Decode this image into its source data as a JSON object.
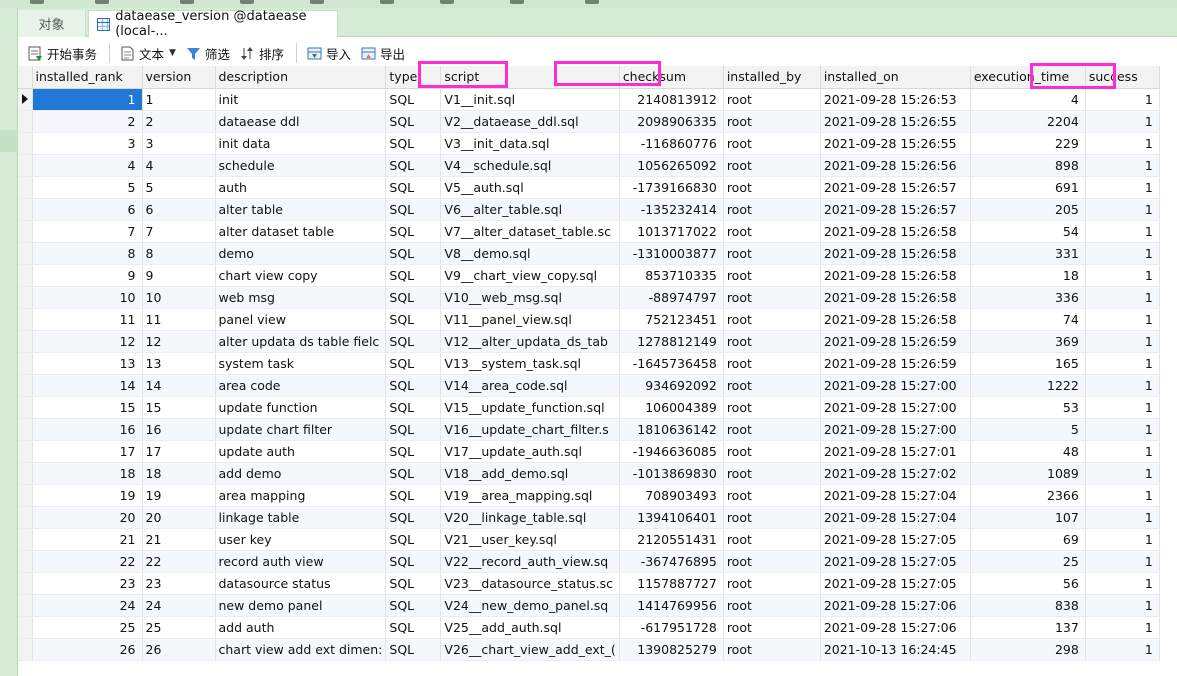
{
  "tabs": {
    "objects_label": "对象",
    "active_label": "dataease_version @dataease (local-..."
  },
  "toolbar": {
    "begin_tx": "开始事务",
    "text": "文本",
    "filter": "筛选",
    "sort": "排序",
    "import": "导入",
    "export": "导出"
  },
  "colors": {
    "accent": "#1f77d6",
    "highlight": "#ff2bd6",
    "panel": "#d6ecd6"
  },
  "table": {
    "columns": [
      "installed_rank",
      "version",
      "description",
      "type",
      "script",
      "checksum",
      "installed_by",
      "installed_on",
      "execution_time",
      "success"
    ],
    "highlighted_columns": [
      "script",
      "checksum",
      "success"
    ],
    "rows": [
      [
        "1",
        "1",
        "init",
        "SQL",
        "V1__init.sql",
        "2140813912",
        "root",
        "2021-09-28 15:26:53",
        "4",
        "1"
      ],
      [
        "2",
        "2",
        "dataease ddl",
        "SQL",
        "V2__dataease_ddl.sql",
        "2098906335",
        "root",
        "2021-09-28 15:26:55",
        "2204",
        "1"
      ],
      [
        "3",
        "3",
        "init data",
        "SQL",
        "V3__init_data.sql",
        "-116860776",
        "root",
        "2021-09-28 15:26:55",
        "229",
        "1"
      ],
      [
        "4",
        "4",
        "schedule",
        "SQL",
        "V4__schedule.sql",
        "1056265092",
        "root",
        "2021-09-28 15:26:56",
        "898",
        "1"
      ],
      [
        "5",
        "5",
        "auth",
        "SQL",
        "V5__auth.sql",
        "-1739166830",
        "root",
        "2021-09-28 15:26:57",
        "691",
        "1"
      ],
      [
        "6",
        "6",
        "alter table",
        "SQL",
        "V6__alter_table.sql",
        "-135232414",
        "root",
        "2021-09-28 15:26:57",
        "205",
        "1"
      ],
      [
        "7",
        "7",
        "alter dataset table",
        "SQL",
        "V7__alter_dataset_table.sc",
        "1013717022",
        "root",
        "2021-09-28 15:26:58",
        "54",
        "1"
      ],
      [
        "8",
        "8",
        "demo",
        "SQL",
        "V8__demo.sql",
        "-1310003877",
        "root",
        "2021-09-28 15:26:58",
        "331",
        "1"
      ],
      [
        "9",
        "9",
        "chart view copy",
        "SQL",
        "V9__chart_view_copy.sql",
        "853710335",
        "root",
        "2021-09-28 15:26:58",
        "18",
        "1"
      ],
      [
        "10",
        "10",
        "web msg",
        "SQL",
        "V10__web_msg.sql",
        "-88974797",
        "root",
        "2021-09-28 15:26:58",
        "336",
        "1"
      ],
      [
        "11",
        "11",
        "panel view",
        "SQL",
        "V11__panel_view.sql",
        "752123451",
        "root",
        "2021-09-28 15:26:58",
        "74",
        "1"
      ],
      [
        "12",
        "12",
        "alter updata ds table fielc",
        "SQL",
        "V12__alter_updata_ds_tab",
        "1278812149",
        "root",
        "2021-09-28 15:26:59",
        "369",
        "1"
      ],
      [
        "13",
        "13",
        "system task",
        "SQL",
        "V13__system_task.sql",
        "-1645736458",
        "root",
        "2021-09-28 15:26:59",
        "165",
        "1"
      ],
      [
        "14",
        "14",
        "area code",
        "SQL",
        "V14__area_code.sql",
        "934692092",
        "root",
        "2021-09-28 15:27:00",
        "1222",
        "1"
      ],
      [
        "15",
        "15",
        "update function",
        "SQL",
        "V15__update_function.sql",
        "106004389",
        "root",
        "2021-09-28 15:27:00",
        "53",
        "1"
      ],
      [
        "16",
        "16",
        "update chart filter",
        "SQL",
        "V16__update_chart_filter.s",
        "1810636142",
        "root",
        "2021-09-28 15:27:00",
        "5",
        "1"
      ],
      [
        "17",
        "17",
        "update auth",
        "SQL",
        "V17__update_auth.sql",
        "-1946636085",
        "root",
        "2021-09-28 15:27:01",
        "48",
        "1"
      ],
      [
        "18",
        "18",
        "add demo",
        "SQL",
        "V18__add_demo.sql",
        "-1013869830",
        "root",
        "2021-09-28 15:27:02",
        "1089",
        "1"
      ],
      [
        "19",
        "19",
        "area mapping",
        "SQL",
        "V19__area_mapping.sql",
        "708903493",
        "root",
        "2021-09-28 15:27:04",
        "2366",
        "1"
      ],
      [
        "20",
        "20",
        "linkage table",
        "SQL",
        "V20__linkage_table.sql",
        "1394106401",
        "root",
        "2021-09-28 15:27:04",
        "107",
        "1"
      ],
      [
        "21",
        "21",
        "user key",
        "SQL",
        "V21__user_key.sql",
        "2120551431",
        "root",
        "2021-09-28 15:27:05",
        "69",
        "1"
      ],
      [
        "22",
        "22",
        "record auth view",
        "SQL",
        "V22__record_auth_view.sq",
        "-367476895",
        "root",
        "2021-09-28 15:27:05",
        "25",
        "1"
      ],
      [
        "23",
        "23",
        "datasource status",
        "SQL",
        "V23__datasource_status.sc",
        "1157887727",
        "root",
        "2021-09-28 15:27:05",
        "56",
        "1"
      ],
      [
        "24",
        "24",
        "new demo panel",
        "SQL",
        "V24__new_demo_panel.sq",
        "1414769956",
        "root",
        "2021-09-28 15:27:06",
        "838",
        "1"
      ],
      [
        "25",
        "25",
        "add auth",
        "SQL",
        "V25__add_auth.sql",
        "-617951728",
        "root",
        "2021-09-28 15:27:06",
        "137",
        "1"
      ],
      [
        "26",
        "26",
        "chart view add ext dimen:",
        "SQL",
        "V26__chart_view_add_ext_(",
        "1390825279",
        "root",
        "2021-10-13 16:24:45",
        "298",
        "1"
      ]
    ]
  }
}
